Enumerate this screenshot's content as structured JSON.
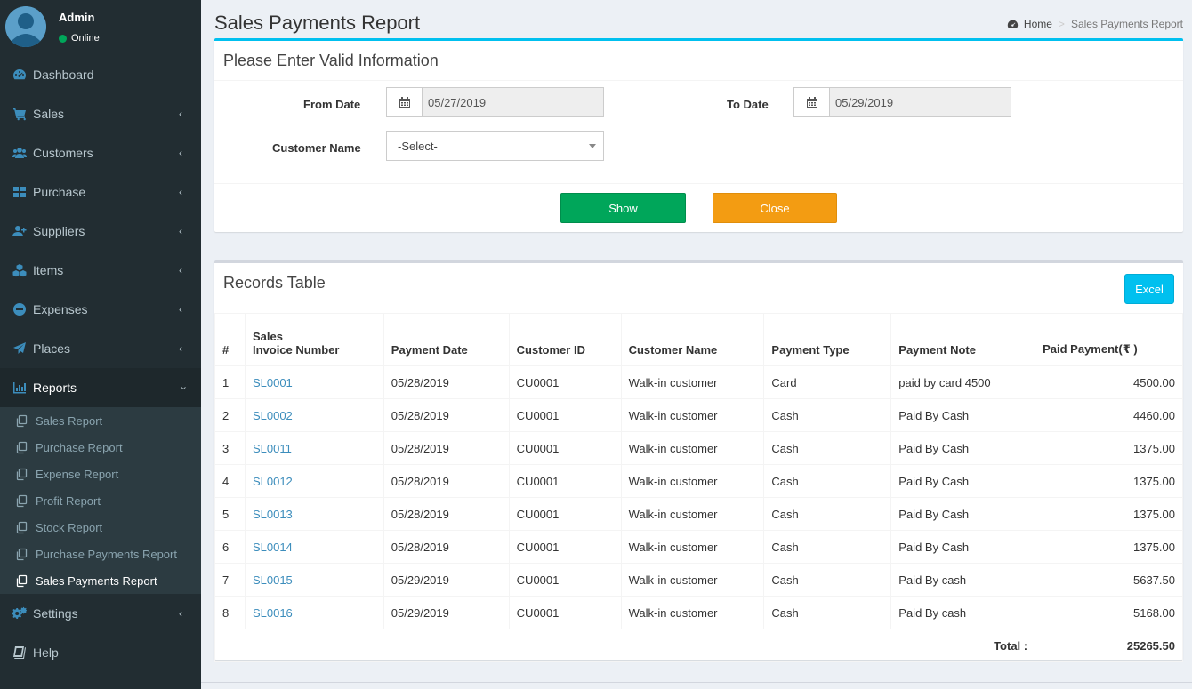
{
  "user": {
    "name": "Admin",
    "status": "Online"
  },
  "sidebar": {
    "items": [
      {
        "label": "Dashboard",
        "icon": "dashboard-icon"
      },
      {
        "label": "Sales",
        "icon": "cart-icon"
      },
      {
        "label": "Customers",
        "icon": "users-icon"
      },
      {
        "label": "Purchase",
        "icon": "grid-icon"
      },
      {
        "label": "Suppliers",
        "icon": "user-plus-icon"
      },
      {
        "label": "Items",
        "icon": "cubes-icon"
      },
      {
        "label": "Expenses",
        "icon": "minus-circle-icon"
      },
      {
        "label": "Places",
        "icon": "paper-plane-icon"
      },
      {
        "label": "Reports",
        "icon": "bar-chart-icon"
      }
    ],
    "reports_sub": [
      {
        "label": "Sales Report"
      },
      {
        "label": "Purchase Report"
      },
      {
        "label": "Expense Report"
      },
      {
        "label": "Profit Report"
      },
      {
        "label": "Stock Report"
      },
      {
        "label": "Purchase Payments Report"
      },
      {
        "label": "Sales Payments Report"
      }
    ],
    "bottom_items": [
      {
        "label": "Settings",
        "icon": "cogs-icon"
      },
      {
        "label": "Help",
        "icon": "book-icon"
      }
    ]
  },
  "header": {
    "title": "Sales Payments Report",
    "breadcrumb_home": "Home",
    "breadcrumb_current": "Sales Payments Report"
  },
  "form": {
    "title": "Please Enter Valid Information",
    "from_date_label": "From Date",
    "from_date_value": "05/27/2019",
    "to_date_label": "To Date",
    "to_date_value": "05/29/2019",
    "customer_label": "Customer Name",
    "customer_selected": "-Select-",
    "show_label": "Show",
    "close_label": "Close"
  },
  "records": {
    "title": "Records Table",
    "excel_label": "Excel",
    "columns": [
      "#",
      "Sales",
      "Invoice Number",
      "Payment Date",
      "Customer ID",
      "Customer Name",
      "Payment Type",
      "Payment Note",
      "Paid Payment(₹ )"
    ],
    "rows": [
      [
        "1",
        "SL0001",
        "05/28/2019",
        "CU0001",
        "Walk-in customer",
        "Card",
        "paid by card 4500",
        "4500.00"
      ],
      [
        "2",
        "SL0002",
        "05/28/2019",
        "CU0001",
        "Walk-in customer",
        "Cash",
        "Paid By Cash",
        "4460.00"
      ],
      [
        "3",
        "SL0011",
        "05/28/2019",
        "CU0001",
        "Walk-in customer",
        "Cash",
        "Paid By Cash",
        "1375.00"
      ],
      [
        "4",
        "SL0012",
        "05/28/2019",
        "CU0001",
        "Walk-in customer",
        "Cash",
        "Paid By Cash",
        "1375.00"
      ],
      [
        "5",
        "SL0013",
        "05/28/2019",
        "CU0001",
        "Walk-in customer",
        "Cash",
        "Paid By Cash",
        "1375.00"
      ],
      [
        "6",
        "SL0014",
        "05/28/2019",
        "CU0001",
        "Walk-in customer",
        "Cash",
        "Paid By Cash",
        "1375.00"
      ],
      [
        "7",
        "SL0015",
        "05/29/2019",
        "CU0001",
        "Walk-in customer",
        "Cash",
        "Paid By cash",
        "5637.50"
      ],
      [
        "8",
        "SL0016",
        "05/29/2019",
        "CU0001",
        "Walk-in customer",
        "Cash",
        "Paid By cash",
        "5168.00"
      ]
    ],
    "total_label": "Total :",
    "total_value": "25265.50"
  },
  "colors": {
    "sidebar_bg": "#222d32",
    "accent_blue": "#3c8dbc",
    "show_green": "#00a65a",
    "close_orange": "#f39c12",
    "excel_cyan": "#00c0ef"
  }
}
